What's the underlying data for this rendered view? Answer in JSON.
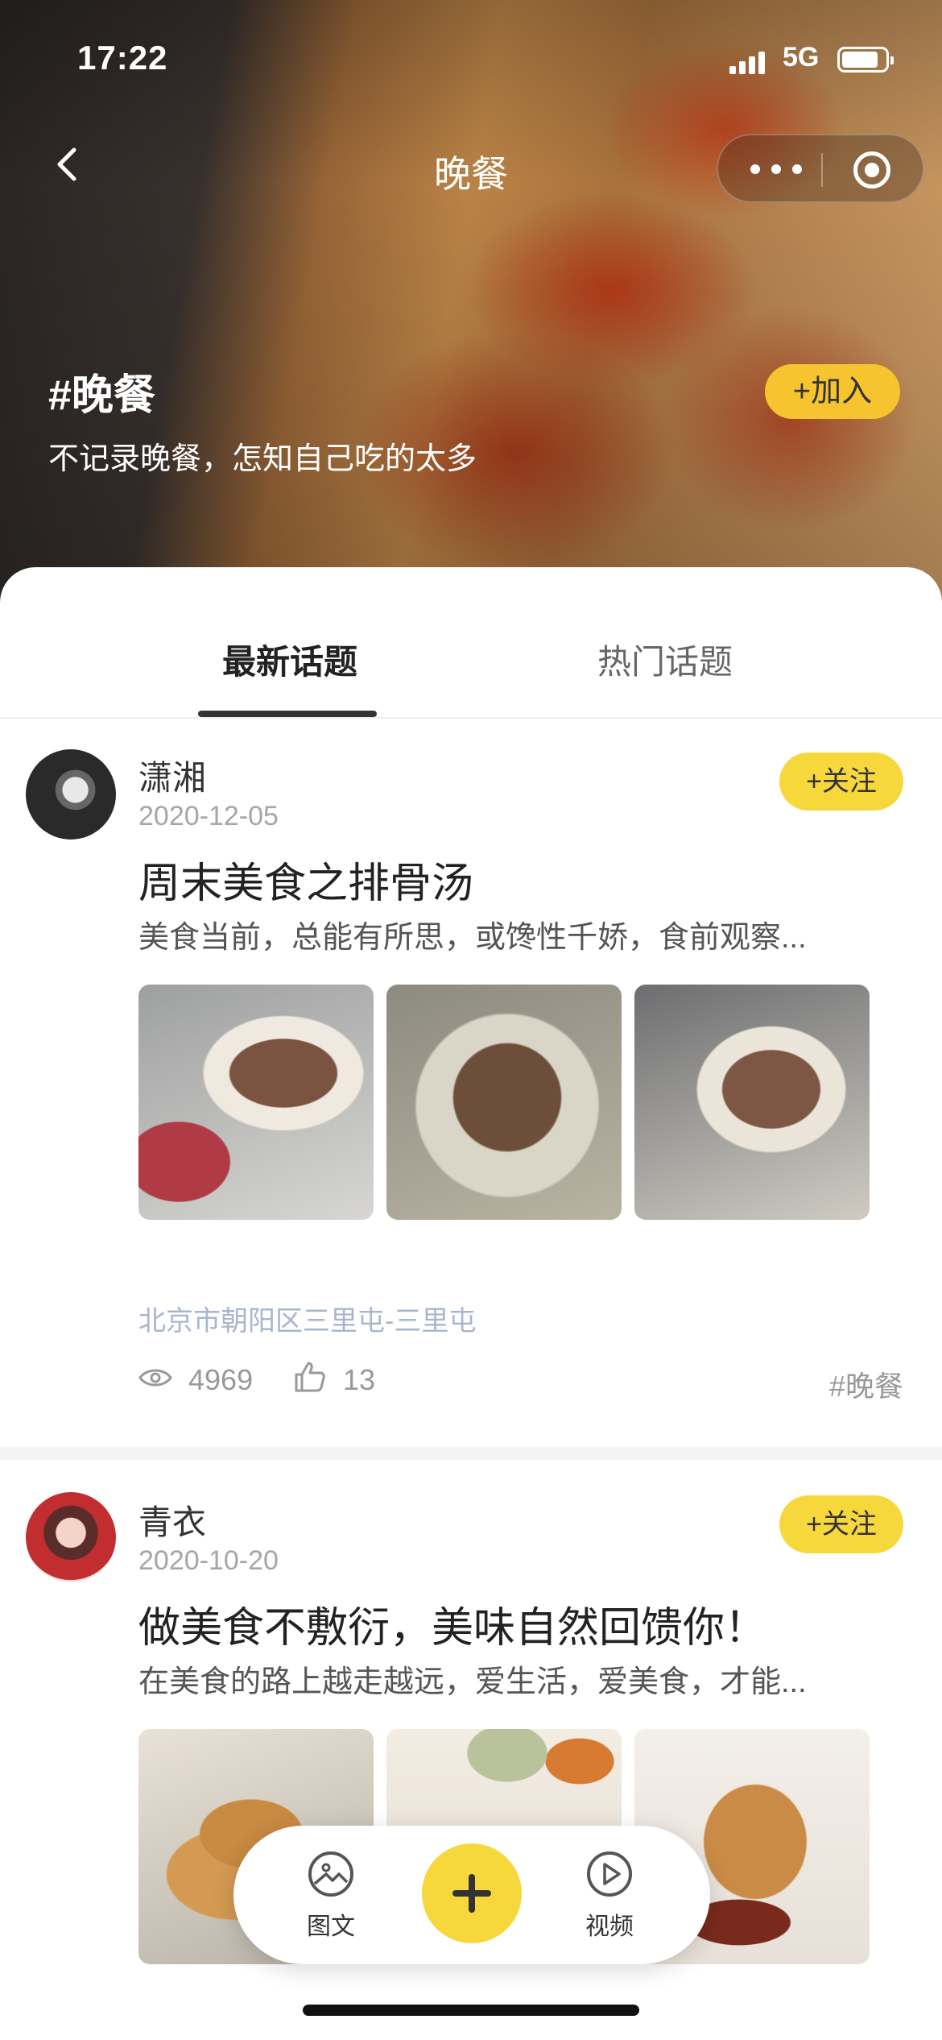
{
  "status_bar": {
    "time": "17:22",
    "network": "5G"
  },
  "nav": {
    "title": "晚餐"
  },
  "topic": {
    "title": "#晚餐",
    "description": "不记录晚餐，怎知自己吃的太多",
    "join_label": "+加入"
  },
  "tabs": [
    {
      "label": "最新话题",
      "active": true
    },
    {
      "label": "热门话题",
      "active": false
    }
  ],
  "posts": [
    {
      "author": "潇湘",
      "date": "2020-12-05",
      "follow_label": "+关注",
      "title": "周末美食之排骨汤",
      "summary": "美食当前，总能有所思，或馋性千娇，食前观察...",
      "location": "北京市朝阳区三里屯-三里屯",
      "views": "4969",
      "likes": "13",
      "tag": "#晚餐"
    },
    {
      "author": "青衣",
      "date": "2020-10-20",
      "follow_label": "+关注",
      "title": "做美食不敷衍，美味自然回馈你！",
      "summary": "在美食的路上越走越远，爱生活，爱美食，才能..."
    }
  ],
  "toolbar": {
    "image_text_label": "图文",
    "video_label": "视频"
  },
  "colors": {
    "accent_yellow": "#f6d83c",
    "join_orange": "#f5c42f",
    "location_blue": "#a9b4cf"
  }
}
